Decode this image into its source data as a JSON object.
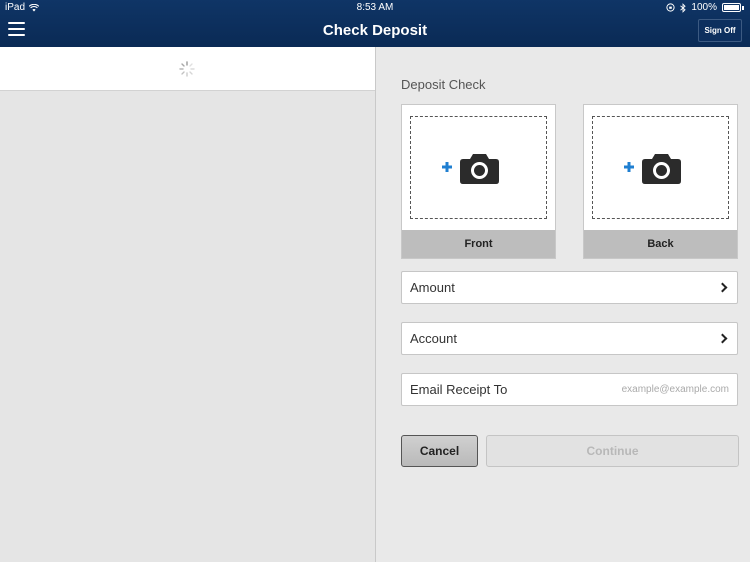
{
  "status_bar": {
    "carrier": "iPad",
    "time": "8:53 AM",
    "battery": "100%"
  },
  "header": {
    "title": "Check Deposit",
    "signoff_label": "Sign Off"
  },
  "deposit": {
    "section_title": "Deposit Check",
    "front_label": "Front",
    "back_label": "Back",
    "amount_label": "Amount",
    "account_label": "Account",
    "email_label": "Email Receipt To",
    "email_placeholder": "example@example.com",
    "cancel_label": "Cancel",
    "continue_label": "Continue"
  },
  "colors": {
    "header_bg": "#0f3566",
    "accent_plus": "#1f7fd1",
    "camera": "#2b2b2b"
  },
  "icons": [
    "wifi-icon",
    "rotation-lock-icon",
    "bluetooth-icon",
    "battery-icon",
    "menu-icon",
    "spinner-icon",
    "camera-add-icon",
    "chevron-right-icon",
    "drag-handle-icon"
  ]
}
